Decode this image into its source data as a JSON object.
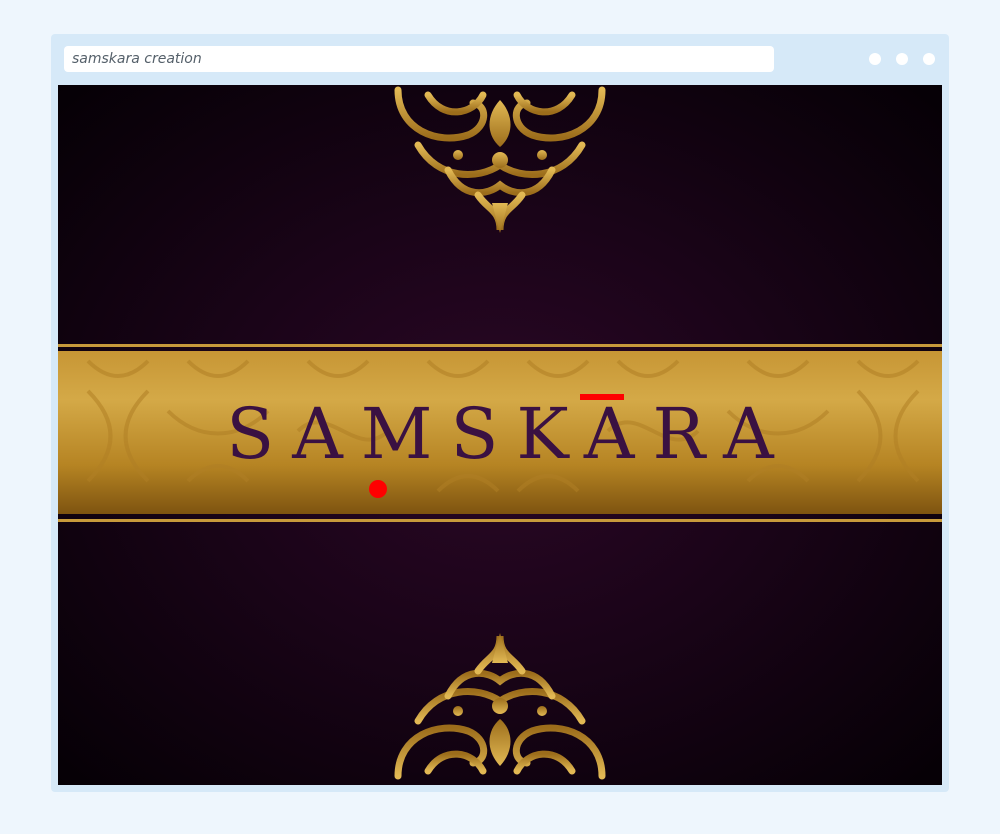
{
  "window": {
    "address_text": "samskara creation"
  },
  "page": {
    "brand_text": "SAMSKARA"
  },
  "colors": {
    "background": "#1a0418",
    "gold": "#c79a3b",
    "brand_text": "#3a1142",
    "marker": "#ff0000"
  },
  "icons": {
    "window_controls": [
      "dot-icon",
      "dot-icon",
      "dot-icon"
    ],
    "ornaments": [
      "ornament-top-icon",
      "ornament-bottom-icon"
    ]
  }
}
